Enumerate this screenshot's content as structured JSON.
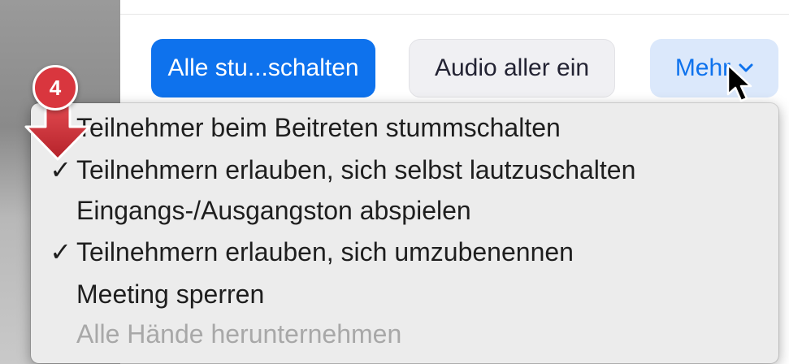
{
  "toolbar": {
    "mute_all_label": "Alle stu...schalten",
    "unmute_all_label": "Audio aller ein",
    "more_label": "Mehr"
  },
  "badge": {
    "number": "4"
  },
  "menu": {
    "items": [
      {
        "label": "Teilnehmer beim Beitreten stummschalten",
        "checked": false,
        "enabled": true,
        "check": ""
      },
      {
        "label": "Teilnehmern erlauben, sich selbst lautzuschalten",
        "checked": true,
        "enabled": true,
        "check": "✓"
      },
      {
        "label": "Eingangs-/Ausgangston abspielen",
        "checked": false,
        "enabled": true,
        "check": ""
      },
      {
        "label": "Teilnehmern erlauben, sich umzubenennen",
        "checked": true,
        "enabled": true,
        "check": "✓"
      },
      {
        "label": "Meeting sperren",
        "checked": false,
        "enabled": true,
        "check": ""
      },
      {
        "label": "Alle Hände herunternehmen",
        "checked": false,
        "enabled": false,
        "check": ""
      }
    ]
  },
  "colors": {
    "primary": "#0e72ed",
    "more_bg": "#dbe8fb",
    "badge_red": "#d9363e",
    "menu_bg": "#ececec",
    "disabled_text": "#a8a8a8"
  },
  "icons": {
    "more_chevron": "chevron-down-icon",
    "check": "checkmark-icon",
    "pointer": "mouse-pointer-icon",
    "step_arrow": "down-arrow-icon"
  }
}
